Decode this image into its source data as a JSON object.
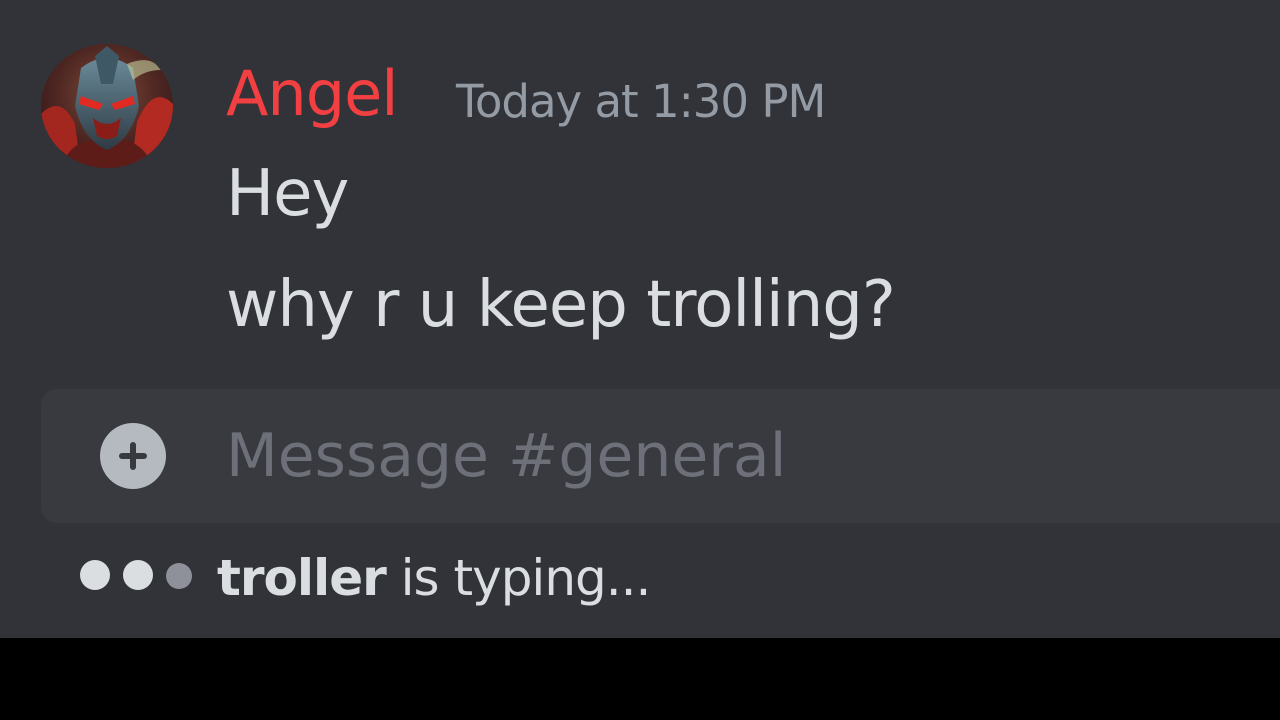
{
  "message": {
    "author": "Angel",
    "author_color": "#f23f42",
    "timestamp": "Today at 1:30 PM",
    "lines": [
      "Hey",
      "why r u keep trolling?"
    ]
  },
  "composer": {
    "placeholder": "Message #general",
    "attach_icon": "plus-circle-icon"
  },
  "typing_indicator": {
    "user": "troller",
    "text": " is typing..."
  },
  "colors": {
    "chat_background": "#313338",
    "composer_background": "#383a40",
    "text": "#dbdee1",
    "muted_text": "#949ba4"
  }
}
